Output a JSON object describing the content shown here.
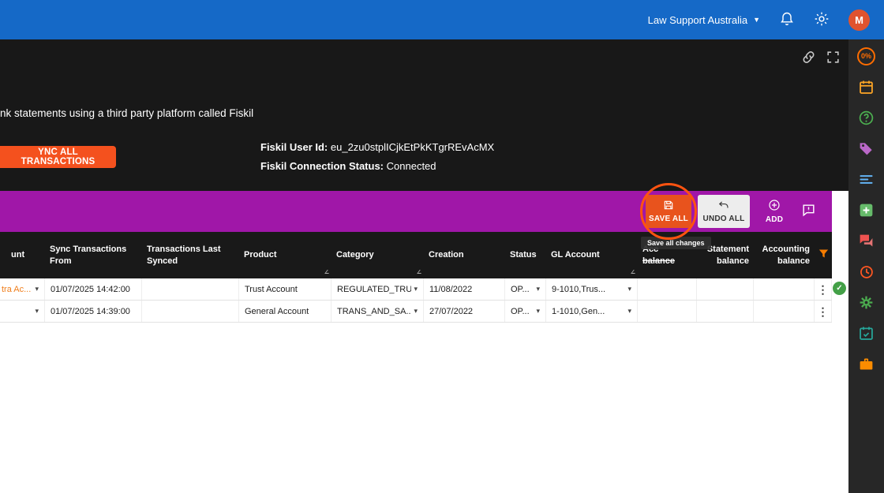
{
  "colors": {
    "topbar_blue": "#1569c7",
    "panel_dark": "#181818",
    "toolbar_purple": "#a017a8",
    "accent_orange": "#f4511e",
    "row_link_orange": "#ef7d1a",
    "success_green": "#43a047",
    "annotation_ring": "#ff5310"
  },
  "topbar": {
    "account_label": "Law Support Australia",
    "avatar_initial": "M"
  },
  "sidebar": {
    "progress_badge": "0%"
  },
  "panel": {
    "intro_text": "nk statements using a third party platform called Fiskil",
    "sync_button_label": "YNC ALL TRANSACTIONS",
    "fiskil_user_id_label": "Fiskil User Id:",
    "fiskil_user_id_value": "eu_2zu0stplICjkEtPkKTgrREvAcMX",
    "fiskil_status_label": "Fiskil Connection Status:",
    "fiskil_status_value": "Connected"
  },
  "toolbar": {
    "save_all_label": "SAVE ALL",
    "undo_all_label": "UNDO ALL",
    "add_label": "ADD",
    "tooltip": "Save all changes"
  },
  "table": {
    "columns": [
      {
        "label": "unt"
      },
      {
        "label": "Sync Transactions From"
      },
      {
        "label": "Transactions Last Synced"
      },
      {
        "label": "Product"
      },
      {
        "label": "Category"
      },
      {
        "label": "Creation"
      },
      {
        "label": "Status"
      },
      {
        "label": "GL Account"
      },
      {
        "label": "Acc balance"
      },
      {
        "label": "Statement balance"
      },
      {
        "label": "Accounting balance"
      }
    ],
    "rows": [
      {
        "account": "tra Ac...",
        "sync_from": "01/07/2025 14:42:00",
        "last_synced": "",
        "product": "Trust Account",
        "category": "REGULATED_TRU...",
        "creation": "11/08/2022",
        "status": "OP...",
        "gl_account": "9-1010,Trus...",
        "acc_balance": "",
        "statement_balance": "",
        "accounting_balance": ""
      },
      {
        "account": "",
        "sync_from": "01/07/2025 14:39:00",
        "last_synced": "",
        "product": "General Account",
        "category": "TRANS_AND_SA...",
        "creation": "27/07/2022",
        "status": "OP...",
        "gl_account": "1-1010,Gen...",
        "acc_balance": "",
        "statement_balance": "",
        "accounting_balance": ""
      }
    ]
  }
}
